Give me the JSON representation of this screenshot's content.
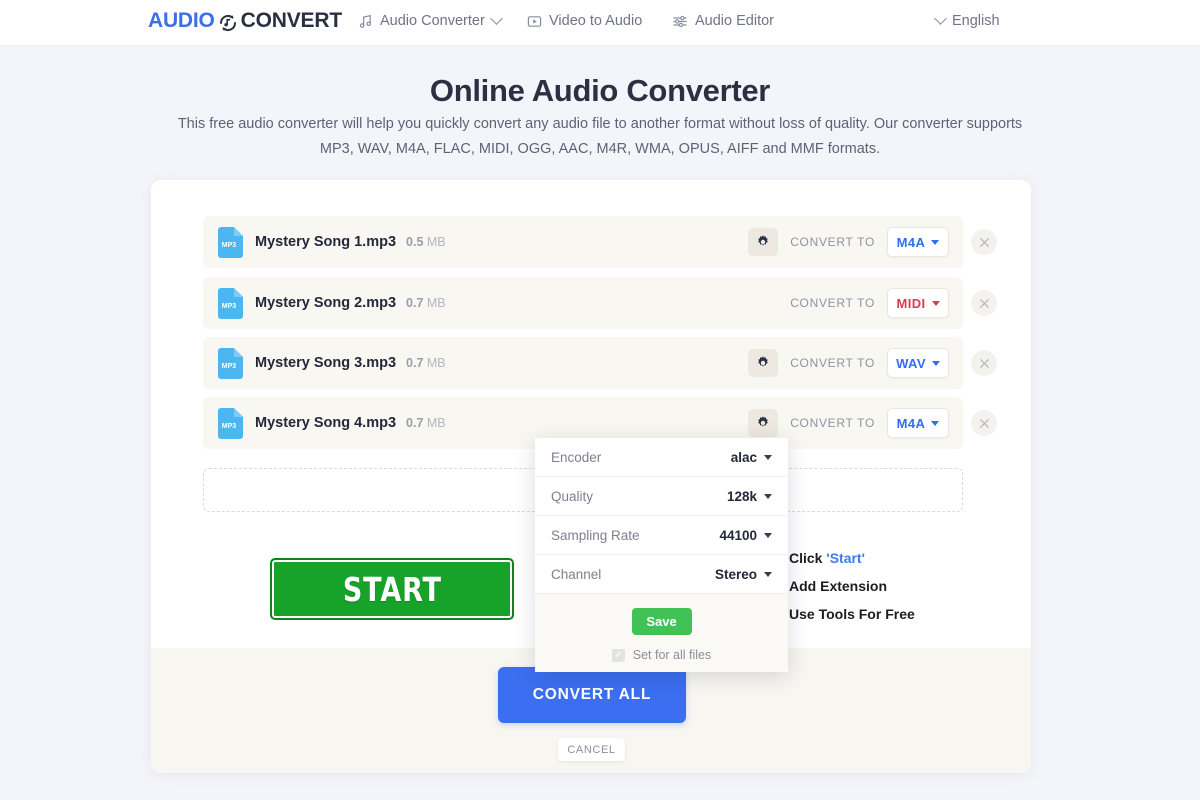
{
  "header": {
    "logo_part1": "AUDIO",
    "logo_part2": "CONVERT",
    "nav": [
      {
        "label": "Audio Converter",
        "icon": "music-note-icon",
        "caret": true
      },
      {
        "label": "Video to Audio",
        "icon": "video-play-icon",
        "caret": false
      },
      {
        "label": "Audio Editor",
        "icon": "sliders-icon",
        "caret": false
      }
    ],
    "language": "English"
  },
  "hero": {
    "title": "Online Audio Converter",
    "subtitle": "This free audio converter will help you quickly convert any audio file to another format without loss of quality. Our converter supports MP3, WAV, M4A, FLAC, MIDI, OGG, AAC, M4R, WMA, OPUS, AIFF and MMF formats."
  },
  "files": {
    "convert_to_label": "CONVERT TO",
    "badge": "MP3",
    "rows": [
      {
        "name": "Mystery Song 1.mp3",
        "size": "0.5",
        "unit": "MB",
        "format": "M4A",
        "format_color": "blue",
        "gear": "visible"
      },
      {
        "name": "Mystery Song 2.mp3",
        "size": "0.7",
        "unit": "MB",
        "format": "MIDI",
        "format_color": "red",
        "gear": "hidden"
      },
      {
        "name": "Mystery Song 3.mp3",
        "size": "0.7",
        "unit": "MB",
        "format": "WAV",
        "format_color": "blue",
        "gear": "visible"
      },
      {
        "name": "Mystery Song 4.mp3",
        "size": "0.7",
        "unit": "MB",
        "format": "M4A",
        "format_color": "blue",
        "gear": "visible"
      }
    ],
    "add_files_symbol": "+"
  },
  "settings_popup": {
    "rows": [
      {
        "label": "Encoder",
        "value": "alac"
      },
      {
        "label": "Quality",
        "value": "128k"
      },
      {
        "label": "Sampling Rate",
        "value": "44100"
      },
      {
        "label": "Channel",
        "value": "Stereo"
      }
    ],
    "save_label": "Save",
    "set_all_label": "Set for all files",
    "set_all_checked": true,
    "checkmark": "✓"
  },
  "actions": {
    "start_label": "START",
    "convert_all_label": "CONVERT ALL",
    "cancel_label": "CANCEL"
  },
  "ad": {
    "line1_prefix": "Click ",
    "line1_highlight": "'Start'",
    "line2": "Add Extension",
    "line3": "Use Tools For Free",
    "close_label": "✕"
  },
  "colors": {
    "accent_blue": "#3b6ef0",
    "start_green": "#17a22a",
    "save_green": "#41c257",
    "midi_red": "#e03a4e",
    "page_bg": "#f4f5fa",
    "row_bg": "#f8f7f2"
  }
}
